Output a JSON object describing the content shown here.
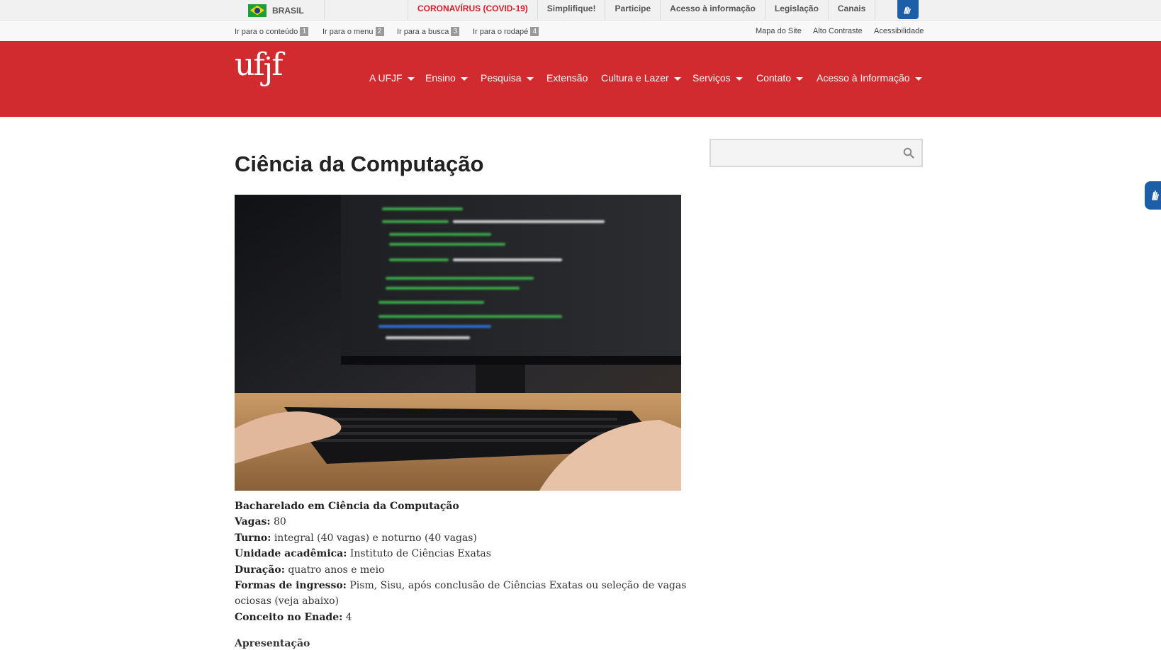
{
  "govbar": {
    "brasil": "BRASIL",
    "links": [
      {
        "label": "CORONAVÍRUS (COVID-19)"
      },
      {
        "label": "Simplifique!"
      },
      {
        "label": "Participe"
      },
      {
        "label": "Acesso à informação"
      },
      {
        "label": "Legislação"
      },
      {
        "label": "Canais"
      }
    ]
  },
  "accessibility": {
    "skip_links": [
      {
        "label": "Ir para o conteúdo",
        "key": "1"
      },
      {
        "label": "Ir para o menu",
        "key": "2"
      },
      {
        "label": "Ir para a busca",
        "key": "3"
      },
      {
        "label": "Ir para o rodapé",
        "key": "4"
      }
    ],
    "right_links": [
      "Mapa do Site",
      "Alto Contraste",
      "Acessibilidade"
    ]
  },
  "header": {
    "logo": "ufjf",
    "brand_color": "#d12b30",
    "nav": [
      {
        "label": "A UFJF"
      },
      {
        "label": "Ensino"
      },
      {
        "label": "Pesquisa"
      },
      {
        "label": "Extensão"
      },
      {
        "label": "Cultura e Lazer"
      },
      {
        "label": "Serviços"
      },
      {
        "label": "Contato"
      },
      {
        "label": "Acesso à Informação"
      }
    ]
  },
  "main": {
    "title": "Ciência da Computação",
    "facts": {
      "heading": "Bacharelado em Ciência da Computação",
      "vagas_label": "Vagas:",
      "vagas_value": " 80",
      "turno_label": "Turno:",
      "turno_value": " integral (40 vagas) e noturno (40 vagas)",
      "unidade_label": "Unidade acadêmica:",
      "unidade_value": " Instituto de Ciências Exatas",
      "duracao_label": "Duração:",
      "duracao_value": " quatro anos e meio",
      "formas_label": "Formas de ingresso:",
      "formas_value": " Pism, Sisu, após conclusão de Ciências Exatas ou seleção de vagas ociosas (veja abaixo)",
      "enade_label": "Conceito no Enade:",
      "enade_value": " 4",
      "next_heading": "Apresentação"
    }
  },
  "search": {
    "placeholder": "",
    "icon": "search-icon"
  }
}
